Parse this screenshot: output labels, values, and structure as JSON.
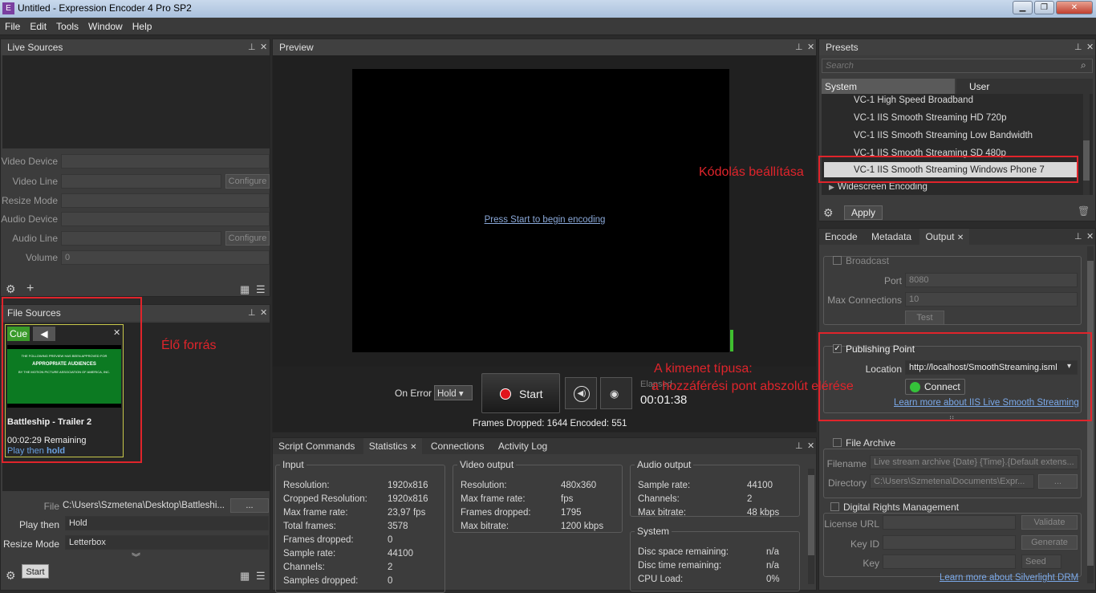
{
  "window": {
    "title": "Untitled - Expression Encoder 4 Pro SP2",
    "icon": "E"
  },
  "menu": [
    "File",
    "Edit",
    "Tools",
    "Window",
    "Help"
  ],
  "live_sources": {
    "title": "Live Sources",
    "video_device": "Video Device",
    "video_line": "Video Line",
    "resize_mode": "Resize Mode",
    "audio_device": "Audio Device",
    "audio_line": "Audio Line",
    "volume": "Volume",
    "volume_value": "0",
    "configure": "Configure"
  },
  "file_sources": {
    "title": "File Sources",
    "cue": "Cue",
    "clip_title": "Battleship - Trailer 2",
    "remaining": "00:02:29 Remaining",
    "play_then_text": "Play then",
    "hold_text": "hold",
    "thumb_line1": "THE FOLLOWING PREVIEW HAS BEEN APPROVED FOR",
    "thumb_line2": "APPROPRIATE AUDIENCES",
    "thumb_line3": "BY THE MOTION PICTURE ASSOCIATION OF AMERICA, INC.",
    "file_label": "File",
    "file_value": "C:\\Users\\Szmetena\\Desktop\\Battleshi...",
    "browse": "...",
    "play_then_label": "Play then",
    "play_then_value": "Hold",
    "resize_label": "Resize Mode",
    "resize_value": "Letterbox",
    "tooltip": "Start"
  },
  "preview": {
    "title": "Preview",
    "prompt": "Press Start to begin encoding",
    "on_error": "On Error",
    "on_error_value": "Hold",
    "start": "Start",
    "elapsed_label": "Elapsed",
    "elapsed": "00:01:38",
    "frames": "Frames Dropped: 1644 Encoded: 551"
  },
  "bottom_tabs": [
    "Script Commands",
    "Statistics",
    "Connections",
    "Activity Log"
  ],
  "stats": {
    "input": {
      "title": "Input",
      "rows": [
        [
          "Resolution:",
          "1920x816"
        ],
        [
          "Cropped Resolution:",
          "1920x816"
        ],
        [
          "Max frame rate:",
          "23,97 fps"
        ],
        [
          "Total frames:",
          "3578"
        ],
        [
          "Frames dropped:",
          "0"
        ],
        [
          "Sample rate:",
          "44100"
        ],
        [
          "Channels:",
          "2"
        ],
        [
          "Samples dropped:",
          "0"
        ]
      ]
    },
    "video": {
      "title": "Video output",
      "rows": [
        [
          "Resolution:",
          "480x360"
        ],
        [
          "Max frame rate:",
          "fps"
        ],
        [
          "Frames dropped:",
          "1795"
        ],
        [
          "Max bitrate:",
          "1200 kbps"
        ]
      ]
    },
    "audio": {
      "title": "Audio output",
      "rows": [
        [
          "Sample rate:",
          "44100"
        ],
        [
          "Channels:",
          "2"
        ],
        [
          "Max bitrate:",
          "48 kbps"
        ]
      ]
    },
    "system": {
      "title": "System",
      "rows": [
        [
          "Disc space remaining:",
          "n/a"
        ],
        [
          "Disc time remaining:",
          "n/a"
        ],
        [
          "CPU Load:",
          "0%"
        ]
      ]
    }
  },
  "presets": {
    "title": "Presets",
    "search_placeholder": "Search",
    "tab_system": "System",
    "tab_user": "User",
    "items": [
      "VC-1 High Speed Broadband",
      "VC-1 IIS Smooth Streaming HD 720p",
      "VC-1 IIS Smooth Streaming Low Bandwidth",
      "VC-1 IIS Smooth Streaming SD 480p",
      "VC-1 IIS Smooth Streaming Windows Phone 7"
    ],
    "group": "Widescreen Encoding",
    "apply": "Apply"
  },
  "output": {
    "tabs": [
      "Encode",
      "Metadata",
      "Output"
    ],
    "broadcast": "Broadcast",
    "port_label": "Port",
    "port_value": "8080",
    "maxconn_label": "Max Connections",
    "maxconn_value": "10",
    "test": "Test",
    "publishing_point": "Publishing Point",
    "location_label": "Location",
    "location_value": "http://localhost/SmoothStreaming.isml",
    "connect": "Connect",
    "learn_iis": "Learn more about IIS Live Smooth Streaming",
    "file_archive": "File Archive",
    "filename_label": "Filename",
    "filename_value": "Live stream archive {Date} {Time}.{Default extens...",
    "directory_label": "Directory",
    "directory_value": "C:\\Users\\Szmetena\\Documents\\Expr...",
    "drm": "Digital Rights Management",
    "license_label": "License URL",
    "validate": "Validate",
    "keyid_label": "Key ID",
    "generate": "Generate",
    "key_label": "Key",
    "seed": "Seed",
    "learn_drm": "Learn more about Silverlight DRM"
  },
  "annotations": {
    "elo_forras": "Élő forrás",
    "kodolas": "Kódolás beállítása",
    "kimenet1": "A kimenet típusa:",
    "kimenet2": "a hozzáférési pont abszolút elérése"
  }
}
